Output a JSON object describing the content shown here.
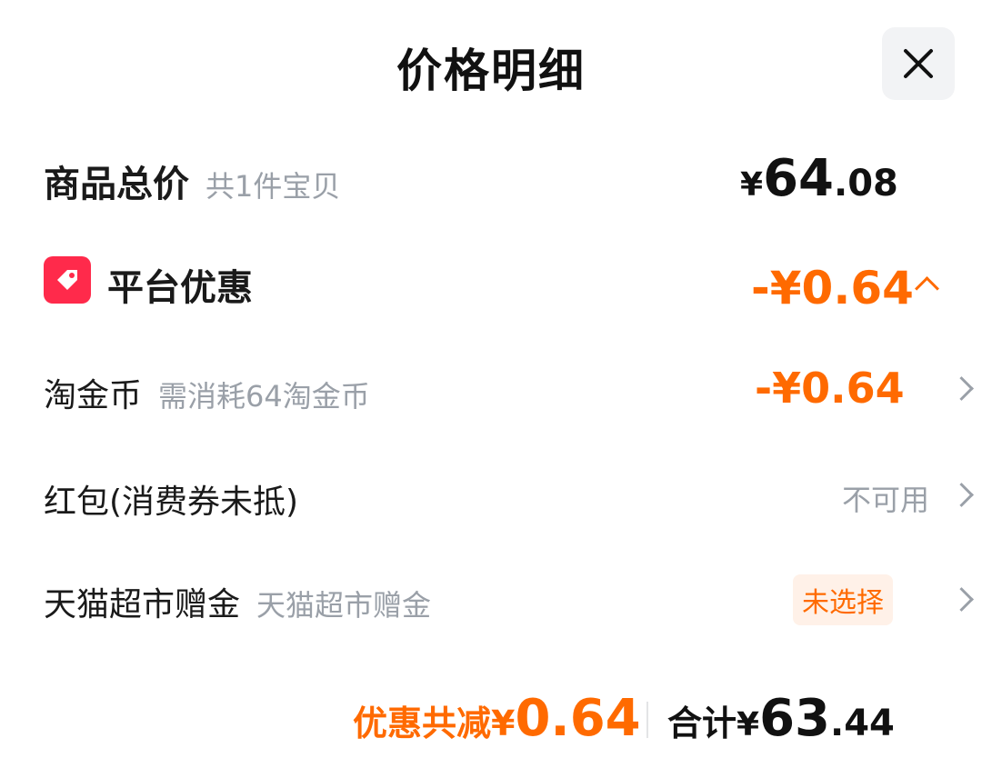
{
  "header": {
    "title": "价格明细",
    "close_icon": "close-icon"
  },
  "goods_total": {
    "label": "商品总价",
    "sub": "共1件宝贝",
    "currency": "¥",
    "price_int": "64",
    "price_dec": ".08"
  },
  "platform_discount": {
    "label": "平台优惠",
    "amount": "-¥0.64",
    "icon": "coupon-tag-icon",
    "icon_color": "#ff2a4b",
    "expanded": true
  },
  "items": [
    {
      "label": "淘金币",
      "sub": "需消耗64淘金币",
      "value": "-¥0.64"
    },
    {
      "label": "红包(消费券未抵)",
      "sub": "",
      "value": "不可用"
    },
    {
      "label": "天猫超市赠金",
      "sub": "天猫超市赠金",
      "value": "未选择"
    }
  ],
  "footer": {
    "discount_label": "优惠共减",
    "discount_currency": "¥",
    "discount_value": "0.64",
    "total_label": "合计",
    "total_currency": "¥",
    "total_int": "63",
    "total_dec": ".44"
  },
  "colors": {
    "accent": "#ff6a00",
    "muted": "#9aa0a8"
  }
}
